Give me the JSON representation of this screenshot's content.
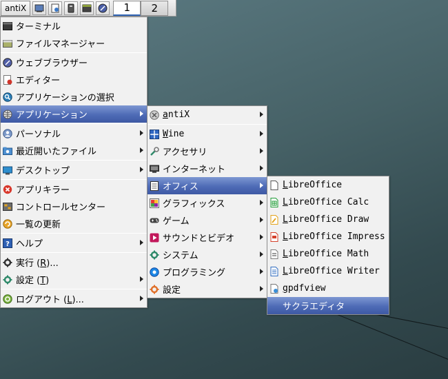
{
  "taskbar": {
    "start_label": "antiX",
    "launchers": [
      {
        "icon": "show-desktop-icon"
      },
      {
        "icon": "file-manager-icon"
      },
      {
        "icon": "usb-icon"
      },
      {
        "icon": "terminal-icon"
      },
      {
        "icon": "browser-icon"
      }
    ],
    "workspaces": [
      "1",
      "2"
    ],
    "active_workspace": "1"
  },
  "main_menu": {
    "items": [
      {
        "label": "ターミナル",
        "icon": "terminal-icon"
      },
      {
        "label": "ファイルマネージャー",
        "icon": "file-manager-icon"
      },
      {
        "label": "ウェブブラウザー",
        "icon": "browser-icon"
      },
      {
        "label": "エディター",
        "icon": "editor-icon"
      },
      {
        "label": "アプリケーションの選択",
        "icon": "app-select-icon"
      },
      {
        "label": "アプリケーション",
        "icon": "applications-icon",
        "submenu": true,
        "selected": true
      },
      {
        "label": "パーソナル",
        "icon": "personal-icon",
        "submenu": true
      },
      {
        "label": "最近開いたファイル",
        "icon": "recent-files-icon",
        "submenu": true
      },
      {
        "label": "デスクトップ",
        "icon": "desktop-icon",
        "submenu": true
      },
      {
        "label": "アプリキラー",
        "icon": "app-killer-icon"
      },
      {
        "label": "コントロールセンター",
        "icon": "control-center-icon"
      },
      {
        "label": "一覧の更新",
        "icon": "refresh-icon"
      },
      {
        "label": "ヘルプ",
        "icon": "help-icon",
        "submenu": true
      },
      {
        "label_prefix": "実行 (",
        "label_key": "R",
        "label_suffix": ")...",
        "icon": "run-icon"
      },
      {
        "label_prefix": "設定 (",
        "label_key": "T",
        "label_suffix": ")",
        "icon": "settings-icon",
        "submenu": true
      },
      {
        "label_prefix": "ログアウト (",
        "label_key": "L",
        "label_suffix": ")...",
        "icon": "logout-icon",
        "submenu": true
      }
    ]
  },
  "applications_menu": {
    "items": [
      {
        "label_key": "a",
        "label_rest": "ntiX",
        "icon": "antix-icon"
      },
      {
        "label_key": "W",
        "label_rest": "ine",
        "icon": "wine-icon"
      },
      {
        "label": "アクセサリ",
        "icon": "accessories-icon"
      },
      {
        "label": "インターネット",
        "icon": "internet-icon"
      },
      {
        "label": "オフィス",
        "icon": "office-icon",
        "selected": true
      },
      {
        "label": "グラフィックス",
        "icon": "graphics-icon"
      },
      {
        "label": "ゲーム",
        "icon": "games-icon"
      },
      {
        "label": "サウンドとビデオ",
        "icon": "multimedia-icon"
      },
      {
        "label": "システム",
        "icon": "system-icon"
      },
      {
        "label": "プログラミング",
        "icon": "programming-icon"
      },
      {
        "label": "設定",
        "icon": "settings-icon"
      }
    ]
  },
  "office_menu": {
    "items": [
      {
        "label_key": "L",
        "label_rest": "ibreOffice",
        "icon": "libreoffice-icon",
        "color": "#555555"
      },
      {
        "label_key": "L",
        "label_rest": "ibreOffice Calc",
        "icon": "libreoffice-calc-icon",
        "color": "#1e9b36"
      },
      {
        "label_key": "L",
        "label_rest": "ibreOffice Draw",
        "icon": "libreoffice-draw-icon",
        "color": "#e3a21a"
      },
      {
        "label_key": "L",
        "label_rest": "ibreOffice Impress",
        "icon": "libreoffice-impress-icon",
        "color": "#d4402b"
      },
      {
        "label_key": "L",
        "label_rest": "ibreOffice Math",
        "icon": "libreoffice-math-icon",
        "color": "#7a7a7a"
      },
      {
        "label_key": "L",
        "label_rest": "ibreOffice Writer",
        "icon": "libreoffice-writer-icon",
        "color": "#2f6cc0"
      },
      {
        "label_key": "g",
        "label_rest": "pdfview",
        "icon": "gpdfview-icon",
        "color": "#3a8fd8"
      },
      {
        "label": "サクラエディタ",
        "selected": true
      }
    ]
  },
  "colors": {
    "selection": "#4e6bb6",
    "menu_bg": "#f1f1f1",
    "desktop": "#466166"
  }
}
